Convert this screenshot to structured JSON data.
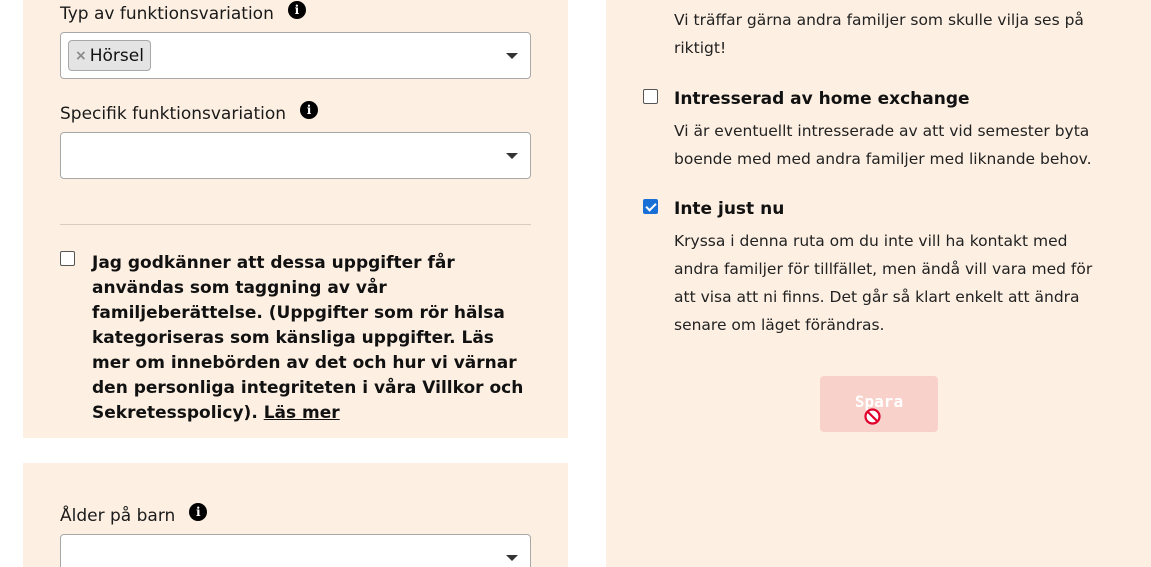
{
  "left": {
    "func_type": {
      "label": "Typ av funktionsvariation",
      "info_icon": "info-icon",
      "tags": [
        {
          "remove_glyph": "×",
          "label": "Hörsel"
        }
      ]
    },
    "specific_func": {
      "label": "Specifik funktionsvariation",
      "info_icon": "info-icon",
      "value": ""
    },
    "consent": {
      "checked": false,
      "text": "Jag godkänner att dessa uppgifter får användas som taggning av vår familjeberättelse. (Uppgifter som rör hälsa kategoriseras som känsliga uppgifter. Läs mer om innebörden av det och hur vi värnar den personliga integriteten i våra Villkor och Sekretesspolicy).",
      "read_more": "Läs mer"
    },
    "child_age": {
      "label": "Ålder på barn",
      "info_icon": "info-icon",
      "value": ""
    }
  },
  "right": {
    "meet_desc": "Vi träffar gärna andra familjer som skulle vilja ses på riktigt!",
    "options": [
      {
        "title": "Intresserad av home exchange",
        "description": "Vi är eventuellt intresserade av att vid semester byta boende med med andra familjer med liknande behov.",
        "checked": false
      },
      {
        "title": "Inte just nu",
        "description": "Kryssa i denna ruta om du inte vill ha kontakt med andra familjer för tillfället, men ändå vill vara med för att visa att ni finns. Det går så klart enkelt att ändra senare om läget förändras.",
        "checked": true
      }
    ],
    "save_button": {
      "label": "Spara",
      "disabled": true,
      "cursor_icon": "not-allowed-cursor-icon"
    }
  },
  "colors": {
    "panel_bg": "#fdf0e3",
    "checkbox_accent": "#1a6fd6",
    "save_disabled_bg": "#f9d1cb",
    "not_allowed_red": "#e0002a"
  }
}
